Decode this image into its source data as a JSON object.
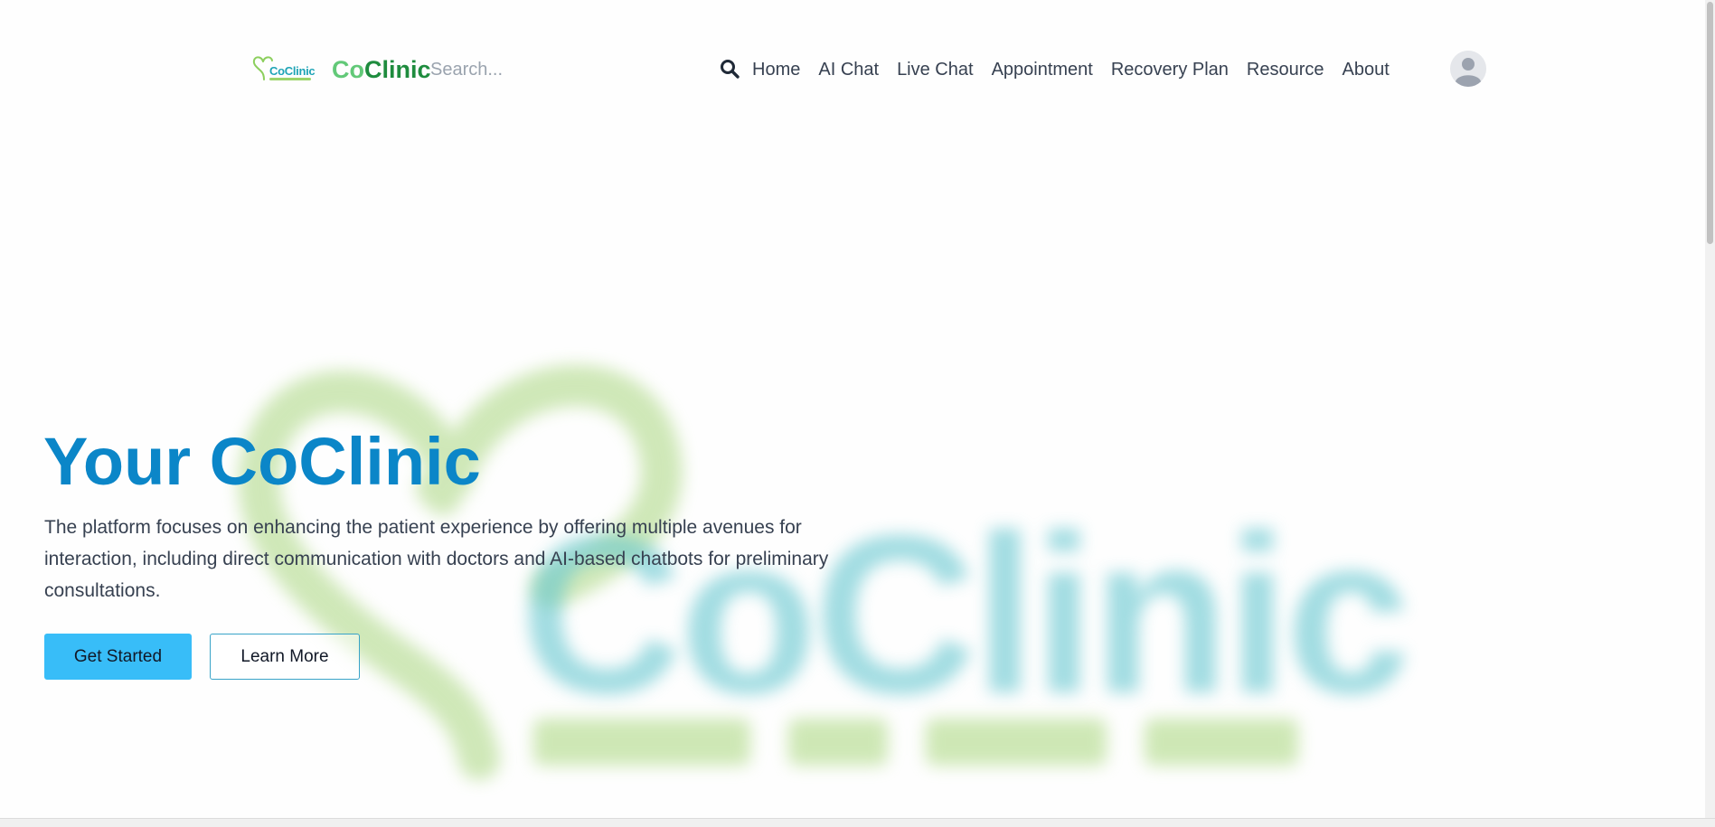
{
  "header": {
    "brand_logo_text": "CoClinic",
    "brand_name_part1": "Co",
    "brand_name_part2": "Clinic",
    "search_placeholder": "Search...",
    "search_icon": "search-icon",
    "nav": {
      "home": "Home",
      "ai_chat": "AI Chat",
      "live_chat": "Live Chat",
      "appointment": "Appointment",
      "recovery_plan": "Recovery Plan",
      "resource": "Resource",
      "about": "About"
    },
    "avatar_icon": "user-avatar-icon"
  },
  "hero": {
    "title": "Your CoClinic",
    "description": "The platform focuses on enhancing the patient experience by offering multiple avenues for interaction, including direct communication with doctors and AI-based chatbots for preliminary consultations.",
    "primary_button": "Get Started",
    "secondary_button": "Learn More",
    "background_logo_text": "CoClinic"
  },
  "colors": {
    "brand_light_green": "#62c978",
    "brand_dark_green": "#1e8c3e",
    "hero_title_blue": "#0b86c8",
    "primary_button": "#38bdf8",
    "text": "#374151"
  }
}
